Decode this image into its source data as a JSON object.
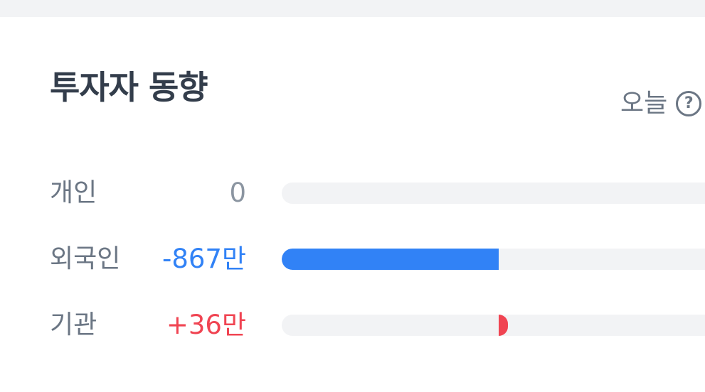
{
  "section": {
    "title": "투자자 동향",
    "period_label": "오늘",
    "help_icon": "question-circle-icon"
  },
  "colors": {
    "negative": "#3182f6",
    "positive": "#f04452",
    "neutral": "#8b95a1",
    "track": "#f2f3f5"
  },
  "investors": [
    {
      "label": "개인",
      "value": "0",
      "trend": "neutral",
      "bar_fraction": 0
    },
    {
      "label": "외국인",
      "value": "-867만",
      "trend": "negative",
      "bar_fraction": -1.0
    },
    {
      "label": "기관",
      "value": "+36만",
      "trend": "positive",
      "bar_fraction": 0.0415
    }
  ]
}
